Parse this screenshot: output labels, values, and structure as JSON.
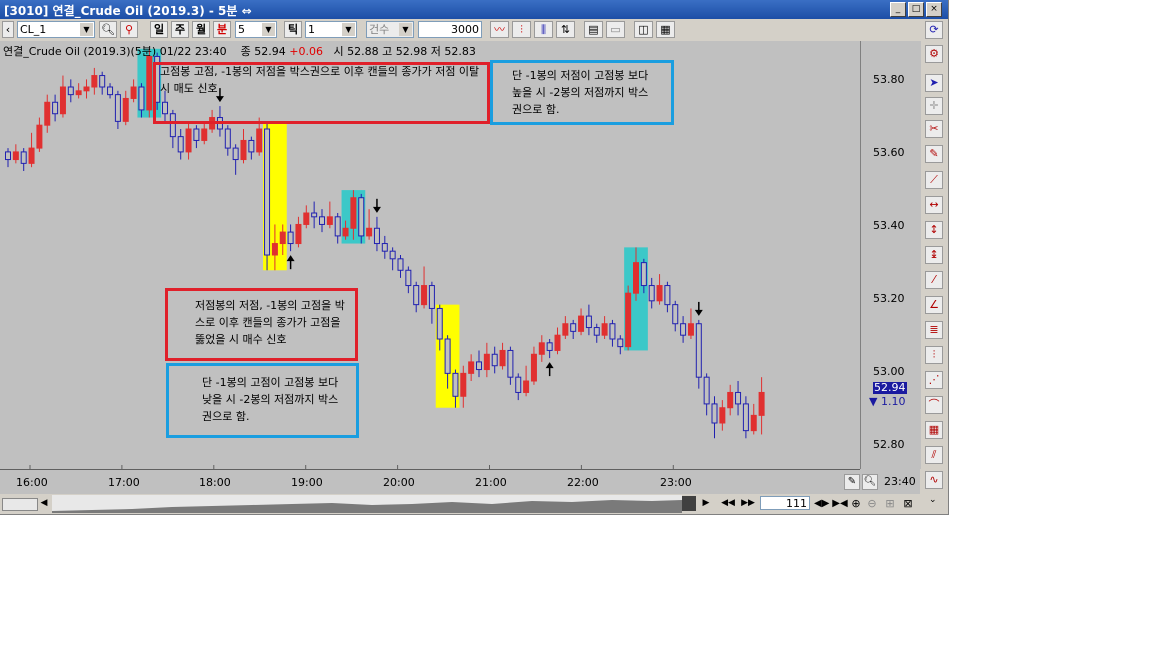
{
  "window": {
    "title": "[3010] 연결_Crude Oil (2019.3) - 5분 ⇔",
    "controls": [
      "_",
      "□",
      "×"
    ]
  },
  "toolbar": {
    "symbol": "CL_1",
    "period_buttons": [
      "일",
      "주",
      "월",
      "분"
    ],
    "minute_value": "5",
    "tick_label": "틱",
    "tick_value": "1",
    "count_label": "건수",
    "count_value": "3000"
  },
  "chart_header": {
    "name": "연결_Crude Oil (2019.3)(5분) 01/22 23:40",
    "close_label": "종",
    "close": "52.94",
    "change": "+0.06",
    "open_label": "시",
    "open": "52.88",
    "high_label": "고",
    "high": "52.98",
    "low_label": "저",
    "low": "52.83"
  },
  "y_axis": {
    "ticks": [
      "53.80",
      "53.60",
      "53.40",
      "53.20",
      "53.00",
      "52.80"
    ],
    "current_price": "52.94",
    "current_change": "▼ 1.10"
  },
  "x_axis": {
    "ticks": [
      "16:00",
      "17:00",
      "18:00",
      "19:00",
      "20:00",
      "21:00",
      "22:00",
      "23:00"
    ],
    "cursor_time": "23:40"
  },
  "scroll": {
    "count": "111"
  },
  "annotations": {
    "top_red": "고점봉 고점, -1봉의 저점을 박스권으로 이후 캔들의 종가가 저점 이탈 시 매도 신호",
    "top_blue": "단 -1봉의 저점이 고점봉 보다 높을 시 -2봉의 저점까지 박스권으로 함.",
    "bottom_red": "저점봉의 저점, -1봉의 고점을 박스로 이후 캔들의 종가가 고점을 뚫었을 시 매수 신호",
    "bottom_blue": "단 -1봉의 고점이 고점봉 보다 낮을 시 -2봉의 저점까지 박스권으로 함."
  },
  "colors": {
    "up": "#e03030",
    "down": "#2020b0",
    "highlight_cyan": "#3cc8c8",
    "highlight_yellow": "#ffff00",
    "annotation_red": "#e0202a",
    "annotation_blue": "#1a9ee0",
    "chart_bg": "#c0c0c0"
  },
  "chart_data": {
    "type": "candlestick",
    "symbol": "연결_Crude Oil (2019.3)",
    "interval": "5분",
    "ylim": [
      52.75,
      53.85
    ],
    "x_ticks": [
      "16:00",
      "17:00",
      "18:00",
      "19:00",
      "20:00",
      "21:00",
      "22:00",
      "23:00"
    ],
    "candles": [
      {
        "o": 53.57,
        "c": 53.55,
        "h": 53.58,
        "l": 53.53
      },
      {
        "o": 53.55,
        "c": 53.57,
        "h": 53.59,
        "l": 53.54
      },
      {
        "o": 53.57,
        "c": 53.54,
        "h": 53.58,
        "l": 53.52
      },
      {
        "o": 53.54,
        "c": 53.58,
        "h": 53.62,
        "l": 53.53
      },
      {
        "o": 53.58,
        "c": 53.64,
        "h": 53.66,
        "l": 53.57
      },
      {
        "o": 53.64,
        "c": 53.7,
        "h": 53.72,
        "l": 53.62
      },
      {
        "o": 53.7,
        "c": 53.67,
        "h": 53.72,
        "l": 53.65
      },
      {
        "o": 53.67,
        "c": 53.74,
        "h": 53.77,
        "l": 53.66
      },
      {
        "o": 53.74,
        "c": 53.72,
        "h": 53.76,
        "l": 53.7
      },
      {
        "o": 53.72,
        "c": 53.73,
        "h": 53.75,
        "l": 53.71
      },
      {
        "o": 53.73,
        "c": 53.74,
        "h": 53.76,
        "l": 53.71
      },
      {
        "o": 53.74,
        "c": 53.77,
        "h": 53.79,
        "l": 53.72
      },
      {
        "o": 53.77,
        "c": 53.74,
        "h": 53.78,
        "l": 53.72
      },
      {
        "o": 53.74,
        "c": 53.72,
        "h": 53.75,
        "l": 53.71
      },
      {
        "o": 53.72,
        "c": 53.65,
        "h": 53.73,
        "l": 53.63
      },
      {
        "o": 53.65,
        "c": 53.71,
        "h": 53.73,
        "l": 53.64
      },
      {
        "o": 53.71,
        "c": 53.74,
        "h": 53.76,
        "l": 53.7
      },
      {
        "o": 53.74,
        "c": 53.68,
        "h": 53.75,
        "l": 53.66
      },
      {
        "o": 53.68,
        "c": 53.82,
        "h": 53.84,
        "l": 53.66
      },
      {
        "o": 53.82,
        "c": 53.7,
        "h": 53.83,
        "l": 53.68
      },
      {
        "o": 53.7,
        "c": 53.67,
        "h": 53.73,
        "l": 53.65
      },
      {
        "o": 53.67,
        "c": 53.61,
        "h": 53.68,
        "l": 53.58
      },
      {
        "o": 53.61,
        "c": 53.57,
        "h": 53.63,
        "l": 53.55
      },
      {
        "o": 53.57,
        "c": 53.63,
        "h": 53.65,
        "l": 53.55
      },
      {
        "o": 53.63,
        "c": 53.6,
        "h": 53.64,
        "l": 53.58
      },
      {
        "o": 53.6,
        "c": 53.63,
        "h": 53.65,
        "l": 53.59
      },
      {
        "o": 53.63,
        "c": 53.66,
        "h": 53.68,
        "l": 53.62
      },
      {
        "o": 53.66,
        "c": 53.63,
        "h": 53.69,
        "l": 53.61
      },
      {
        "o": 53.63,
        "c": 53.58,
        "h": 53.64,
        "l": 53.56
      },
      {
        "o": 53.58,
        "c": 53.55,
        "h": 53.59,
        "l": 53.51
      },
      {
        "o": 53.55,
        "c": 53.6,
        "h": 53.63,
        "l": 53.54
      },
      {
        "o": 53.6,
        "c": 53.57,
        "h": 53.61,
        "l": 53.55
      },
      {
        "o": 53.57,
        "c": 53.63,
        "h": 53.66,
        "l": 53.56
      },
      {
        "o": 53.63,
        "c": 53.3,
        "h": 53.65,
        "l": 53.26
      },
      {
        "o": 53.3,
        "c": 53.33,
        "h": 53.38,
        "l": 53.26
      },
      {
        "o": 53.33,
        "c": 53.36,
        "h": 53.38,
        "l": 53.3
      },
      {
        "o": 53.36,
        "c": 53.33,
        "h": 53.38,
        "l": 53.31
      },
      {
        "o": 53.33,
        "c": 53.38,
        "h": 53.4,
        "l": 53.32
      },
      {
        "o": 53.38,
        "c": 53.41,
        "h": 53.43,
        "l": 53.37
      },
      {
        "o": 53.41,
        "c": 53.4,
        "h": 53.44,
        "l": 53.37
      },
      {
        "o": 53.4,
        "c": 53.38,
        "h": 53.42,
        "l": 53.36
      },
      {
        "o": 53.38,
        "c": 53.4,
        "h": 53.44,
        "l": 53.37
      },
      {
        "o": 53.4,
        "c": 53.35,
        "h": 53.41,
        "l": 53.33
      },
      {
        "o": 53.35,
        "c": 53.37,
        "h": 53.39,
        "l": 53.34
      },
      {
        "o": 53.37,
        "c": 53.45,
        "h": 53.47,
        "l": 53.34
      },
      {
        "o": 53.45,
        "c": 53.35,
        "h": 53.46,
        "l": 53.33
      },
      {
        "o": 53.35,
        "c": 53.37,
        "h": 53.42,
        "l": 53.34
      },
      {
        "o": 53.37,
        "c": 53.33,
        "h": 53.4,
        "l": 53.31
      },
      {
        "o": 53.33,
        "c": 53.31,
        "h": 53.35,
        "l": 53.29
      },
      {
        "o": 53.31,
        "c": 53.29,
        "h": 53.32,
        "l": 53.26
      },
      {
        "o": 53.29,
        "c": 53.26,
        "h": 53.3,
        "l": 53.24
      },
      {
        "o": 53.26,
        "c": 53.22,
        "h": 53.27,
        "l": 53.2
      },
      {
        "o": 53.22,
        "c": 53.17,
        "h": 53.23,
        "l": 53.15
      },
      {
        "o": 53.17,
        "c": 53.22,
        "h": 53.27,
        "l": 53.16
      },
      {
        "o": 53.22,
        "c": 53.16,
        "h": 53.23,
        "l": 53.12
      },
      {
        "o": 53.16,
        "c": 53.08,
        "h": 53.17,
        "l": 53.05
      },
      {
        "o": 53.08,
        "c": 52.99,
        "h": 53.09,
        "l": 52.95
      },
      {
        "o": 52.99,
        "c": 52.93,
        "h": 53.0,
        "l": 52.9
      },
      {
        "o": 52.93,
        "c": 52.99,
        "h": 53.01,
        "l": 52.9
      },
      {
        "o": 52.99,
        "c": 53.02,
        "h": 53.04,
        "l": 52.97
      },
      {
        "o": 53.02,
        "c": 53.0,
        "h": 53.05,
        "l": 52.98
      },
      {
        "o": 53.0,
        "c": 53.04,
        "h": 53.07,
        "l": 52.98
      },
      {
        "o": 53.04,
        "c": 53.01,
        "h": 53.06,
        "l": 52.99
      },
      {
        "o": 53.01,
        "c": 53.05,
        "h": 53.07,
        "l": 53.0
      },
      {
        "o": 53.05,
        "c": 52.98,
        "h": 53.06,
        "l": 52.96
      },
      {
        "o": 52.98,
        "c": 52.94,
        "h": 52.99,
        "l": 52.92
      },
      {
        "o": 52.94,
        "c": 52.97,
        "h": 53.01,
        "l": 52.93
      },
      {
        "o": 52.97,
        "c": 53.04,
        "h": 53.06,
        "l": 52.96
      },
      {
        "o": 53.04,
        "c": 53.07,
        "h": 53.09,
        "l": 53.02
      },
      {
        "o": 53.07,
        "c": 53.05,
        "h": 53.08,
        "l": 53.03
      },
      {
        "o": 53.05,
        "c": 53.09,
        "h": 53.11,
        "l": 53.04
      },
      {
        "o": 53.09,
        "c": 53.12,
        "h": 53.14,
        "l": 53.08
      },
      {
        "o": 53.12,
        "c": 53.1,
        "h": 53.13,
        "l": 53.08
      },
      {
        "o": 53.1,
        "c": 53.14,
        "h": 53.16,
        "l": 53.09
      },
      {
        "o": 53.14,
        "c": 53.11,
        "h": 53.17,
        "l": 53.09
      },
      {
        "o": 53.11,
        "c": 53.09,
        "h": 53.12,
        "l": 53.07
      },
      {
        "o": 53.09,
        "c": 53.12,
        "h": 53.14,
        "l": 53.08
      },
      {
        "o": 53.12,
        "c": 53.08,
        "h": 53.13,
        "l": 53.06
      },
      {
        "o": 53.08,
        "c": 53.06,
        "h": 53.09,
        "l": 53.04
      },
      {
        "o": 53.06,
        "c": 53.2,
        "h": 53.22,
        "l": 53.05
      },
      {
        "o": 53.2,
        "c": 53.28,
        "h": 53.32,
        "l": 53.18
      },
      {
        "o": 53.28,
        "c": 53.22,
        "h": 53.29,
        "l": 53.2
      },
      {
        "o": 53.22,
        "c": 53.18,
        "h": 53.24,
        "l": 53.16
      },
      {
        "o": 53.18,
        "c": 53.22,
        "h": 53.25,
        "l": 53.17
      },
      {
        "o": 53.22,
        "c": 53.17,
        "h": 53.23,
        "l": 53.15
      },
      {
        "o": 53.17,
        "c": 53.12,
        "h": 53.18,
        "l": 53.1
      },
      {
        "o": 53.12,
        "c": 53.09,
        "h": 53.14,
        "l": 53.07
      },
      {
        "o": 53.09,
        "c": 53.12,
        "h": 53.16,
        "l": 53.08
      },
      {
        "o": 53.12,
        "c": 52.98,
        "h": 53.13,
        "l": 52.95
      },
      {
        "o": 52.98,
        "c": 52.91,
        "h": 52.99,
        "l": 52.88
      },
      {
        "o": 52.91,
        "c": 52.86,
        "h": 52.93,
        "l": 52.82
      },
      {
        "o": 52.86,
        "c": 52.9,
        "h": 52.92,
        "l": 52.84
      },
      {
        "o": 52.9,
        "c": 52.94,
        "h": 52.96,
        "l": 52.88
      },
      {
        "o": 52.94,
        "c": 52.91,
        "h": 52.97,
        "l": 52.88
      },
      {
        "o": 52.91,
        "c": 52.84,
        "h": 52.93,
        "l": 52.82
      },
      {
        "o": 52.84,
        "c": 52.88,
        "h": 52.91,
        "l": 52.83
      },
      {
        "o": 52.88,
        "c": 52.94,
        "h": 52.98,
        "l": 52.83
      }
    ],
    "highlight_boxes": [
      {
        "color": "cyan",
        "from_index": 17,
        "to_index": 19
      },
      {
        "color": "yellow",
        "from_index": 33,
        "to_index": 35
      },
      {
        "color": "cyan",
        "from_index": 43,
        "to_index": 45
      },
      {
        "color": "yellow",
        "from_index": 55,
        "to_index": 57
      },
      {
        "color": "cyan",
        "from_index": 79,
        "to_index": 81
      }
    ],
    "signal_arrows": [
      {
        "index": 27,
        "direction": "down"
      },
      {
        "index": 36,
        "direction": "up"
      },
      {
        "index": 47,
        "direction": "down"
      },
      {
        "index": 69,
        "direction": "up"
      },
      {
        "index": 88,
        "direction": "down"
      }
    ]
  }
}
